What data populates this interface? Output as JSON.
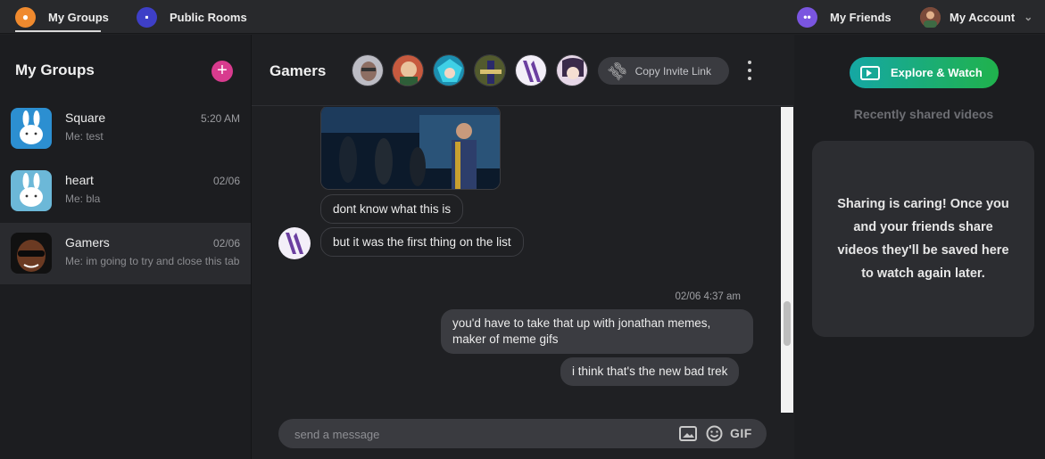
{
  "topnav": {
    "my_groups": "My Groups",
    "public_rooms": "Public Rooms",
    "my_friends": "My Friends",
    "my_account": "My Account"
  },
  "sidebar": {
    "title": "My Groups",
    "groups": [
      {
        "name": "Square",
        "preview": "Me: test",
        "time": "5:20 AM",
        "active": false
      },
      {
        "name": "heart",
        "preview": "Me: bla",
        "time": "02/06",
        "active": false
      },
      {
        "name": "Gamers",
        "preview": "Me: im going to try and close this tab",
        "time": "02/06",
        "active": true
      }
    ]
  },
  "chat": {
    "title": "Gamers",
    "invite_label": "Copy Invite Link",
    "messages": [
      {
        "from": "other",
        "type": "image"
      },
      {
        "from": "other",
        "text": "dont know what this is"
      },
      {
        "from": "other",
        "text": "but it was the first thing on the list"
      },
      {
        "timestamp": "02/06 4:37 am"
      },
      {
        "from": "me",
        "text": "you'd have to take that up with jonathan memes, maker of meme gifs"
      },
      {
        "from": "me",
        "text": "i think that's the new bad trek"
      }
    ],
    "composer_placeholder": "send a message",
    "gif_label": "GIF"
  },
  "rightpanel": {
    "explore_label": "Explore & Watch",
    "recent_title": "Recently shared videos",
    "empty_message": "Sharing is caring! Once you and your friends share videos they'll be saved here to watch again later."
  },
  "colors": {
    "accent_pink": "#d83b8e",
    "explore_start": "#15a7a4",
    "explore_end": "#20b24c",
    "nav_orange": "#f08a2e"
  }
}
